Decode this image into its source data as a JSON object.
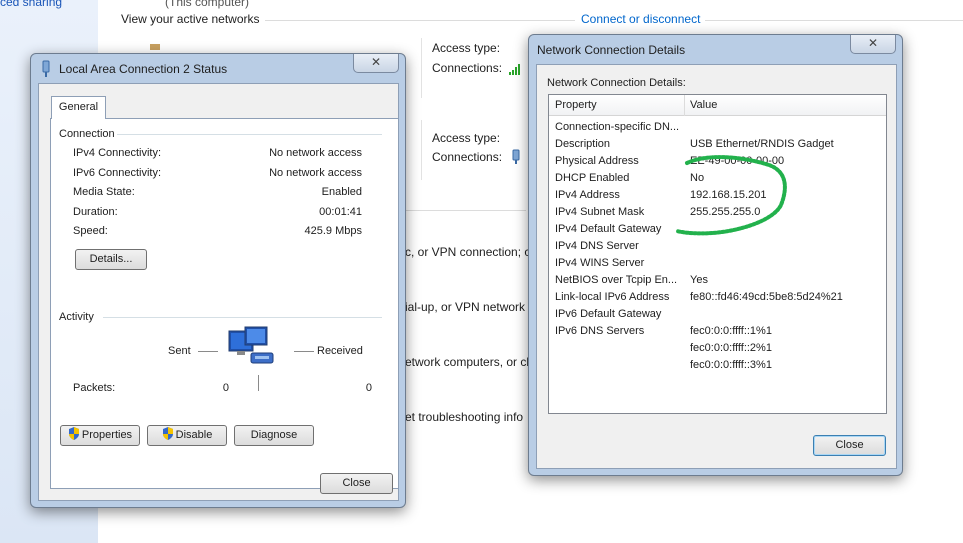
{
  "background": {
    "sidebar_link": "ced sharing",
    "this_computer": "(This computer)",
    "view_networks": "View your active networks",
    "connect_link": "Connect or disconnect",
    "access_type_1": "Access type:",
    "connections_1": "Connections:",
    "access_type_2": "Access type:",
    "connections_2": "Connections:",
    "line_1": "c, or VPN connection; c",
    "line_2": "ial-up, or VPN network",
    "line_3": "etwork computers, or ch",
    "line_4": "et troubleshooting info"
  },
  "status_dialog": {
    "title": "Local Area Connection 2 Status",
    "close_glyph": "✕",
    "tab_general": "General",
    "connection_group": "Connection",
    "rows": [
      {
        "label": "IPv4 Connectivity:",
        "value": "No network access"
      },
      {
        "label": "IPv6 Connectivity:",
        "value": "No network access"
      },
      {
        "label": "Media State:",
        "value": "Enabled"
      },
      {
        "label": "Duration:",
        "value": "00:01:41"
      },
      {
        "label": "Speed:",
        "value": "425.9 Mbps"
      }
    ],
    "details_button": "Details...",
    "activity_group": "Activity",
    "sent_label": "Sent",
    "received_label": "Received",
    "packets_label": "Packets:",
    "packets_sent": "0",
    "packets_received": "0",
    "properties_button": "Properties",
    "disable_button": "Disable",
    "diagnose_button": "Diagnose",
    "close_button": "Close"
  },
  "details_dialog": {
    "title": "Network Connection Details",
    "close_glyph": "✕",
    "section_label": "Network Connection Details:",
    "col_property": "Property",
    "col_value": "Value",
    "rows": [
      {
        "property": "Connection-specific DN...",
        "value": ""
      },
      {
        "property": "Description",
        "value": "USB Ethernet/RNDIS Gadget"
      },
      {
        "property": "Physical Address",
        "value": "EE-49-00-00-00-00"
      },
      {
        "property": "DHCP Enabled",
        "value": "No"
      },
      {
        "property": "IPv4 Address",
        "value": "192.168.15.201"
      },
      {
        "property": "IPv4 Subnet Mask",
        "value": "255.255.255.0"
      },
      {
        "property": "IPv4 Default Gateway",
        "value": ""
      },
      {
        "property": "IPv4 DNS Server",
        "value": ""
      },
      {
        "property": "IPv4 WINS Server",
        "value": ""
      },
      {
        "property": "NetBIOS over Tcpip En...",
        "value": "Yes"
      },
      {
        "property": "Link-local IPv6 Address",
        "value": "fe80::fd46:49cd:5be8:5d24%21"
      },
      {
        "property": "IPv6 Default Gateway",
        "value": ""
      },
      {
        "property": "IPv6 DNS Servers",
        "value": "fec0:0:0:ffff::1%1"
      },
      {
        "property": "",
        "value": "fec0:0:0:ffff::2%1"
      },
      {
        "property": "",
        "value": "fec0:0:0:ffff::3%1"
      }
    ],
    "close_button": "Close"
  },
  "colors": {
    "window_frame": "#b9cde5",
    "link": "#0066cc",
    "annotation_green": "#22b14c"
  }
}
